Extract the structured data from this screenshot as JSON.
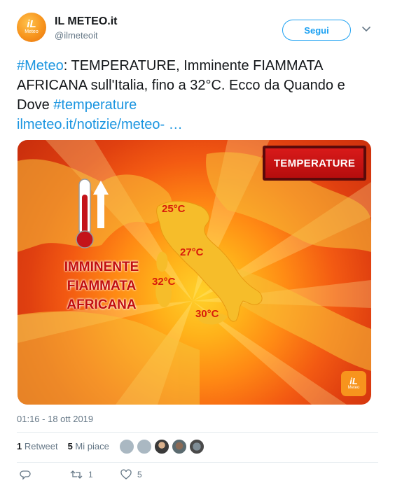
{
  "author": {
    "name": "IL METEO.it",
    "handle": "@ilmeteoit",
    "avatar_text": "iL",
    "avatar_subtext": "Meteo"
  },
  "follow_label": "Segui",
  "tweet": {
    "hashtag1": "#Meteo",
    "text_main": ": TEMPERATURE, Imminente FIAMMATA AFRICANA sull'Italia, fino a 32°C. Ecco da Quando e Dove ",
    "hashtag2": "#temperature",
    "link": "ilmeteo.it/notizie/meteo-   …"
  },
  "media": {
    "badge": "TEMPERATURE",
    "headline_lines": [
      "IMMINENTE",
      "FIAMMATA",
      "AFRICANA"
    ],
    "cities": [
      {
        "label": "25°C"
      },
      {
        "label": "27°C"
      },
      {
        "label": "32°C"
      },
      {
        "label": "30°C"
      }
    ],
    "logo_text": "iL",
    "logo_sub": "Meteo"
  },
  "timestamp": "01:16 - 18 ott 2019",
  "stats": {
    "retweets_count": "1",
    "retweets_label": "Retweet",
    "likes_count": "5",
    "likes_label": "Mi piace"
  },
  "actions": {
    "retweet_count": "1",
    "like_count": "5"
  },
  "colors": {
    "accent": "#1da1f2",
    "link": "#1b95e0",
    "muted": "#657786"
  }
}
